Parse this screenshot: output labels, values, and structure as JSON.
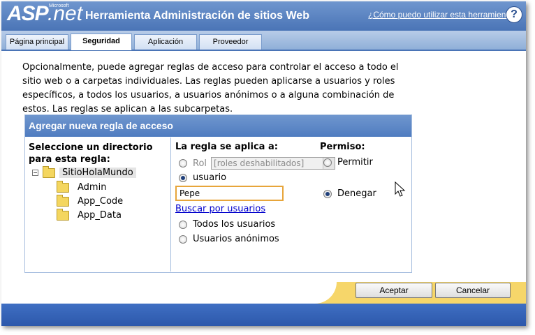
{
  "header": {
    "logo_asp": "ASP",
    "logo_microsoft": "Microsoft",
    "logo_net": ".net",
    "title": "Herramienta Administración de sitios Web",
    "help_link": "¿Cómo puedo utilizar esta herramienta?",
    "help_icon_glyph": "?"
  },
  "tabs": [
    {
      "label": "Página principal"
    },
    {
      "label": "Seguridad",
      "active": true
    },
    {
      "label": "Aplicación"
    },
    {
      "label": "Proveedor"
    }
  ],
  "intro_text": "Opcionalmente, puede agregar reglas de acceso para controlar el acceso a todo el sitio web o a carpetas individuales. Las reglas pueden aplicarse a usuarios y roles específicos, a todos los usuarios, a usuarios anónimos o a alguna combinación de estos. Las reglas se aplican a las subcarpetas.",
  "panel": {
    "title": "Agregar nueva regla de acceso",
    "directory_heading": "Seleccione un directorio para esta regla:",
    "tree": {
      "root": "SitioHolaMundo",
      "children": [
        "Admin",
        "App_Code",
        "App_Data"
      ]
    },
    "rule_heading": "La regla se aplica a:",
    "role_label": "Rol",
    "role_select_value": "[roles deshabilitados]",
    "user_label": "usuario",
    "user_value": "Pepe",
    "search_users_link": "Buscar por usuarios",
    "all_users_label": "Todos los usuarios",
    "anonymous_users_label": "Usuarios anónimos",
    "permission_heading": "Permiso:",
    "allow_label": "Permitir",
    "deny_label": "Denegar",
    "selected_applies_to": "usuario",
    "selected_permission": "Denegar"
  },
  "buttons": {
    "accept": "Aceptar",
    "cancel": "Cancelar"
  },
  "colors": {
    "header_blue": "#4a74b6",
    "footer_yellow": "#f6d66a",
    "input_border": "#e7a53a"
  }
}
